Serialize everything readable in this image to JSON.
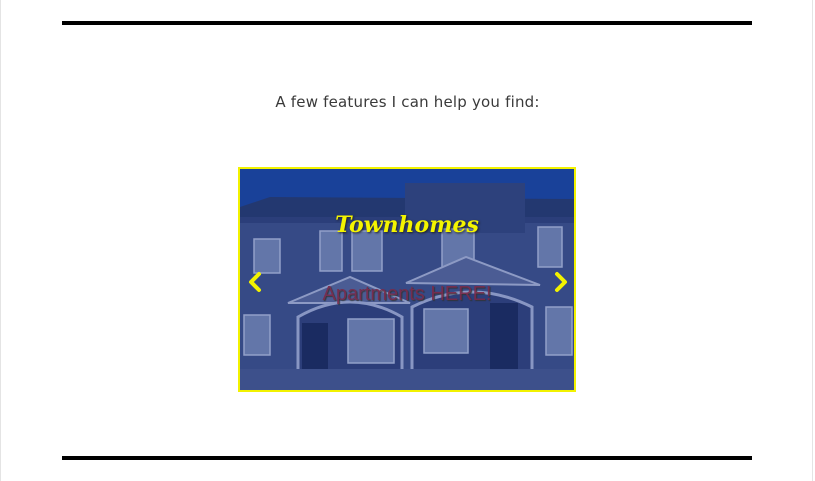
{
  "intro": {
    "text": "A few features I can help you find:"
  },
  "slider": {
    "slide_title": "Townhomes",
    "slide_caption": "Apartments HERE!",
    "prev_icon": "chevron-left-icon",
    "next_icon": "chevron-right-icon",
    "accent_color": "#f2f200"
  }
}
